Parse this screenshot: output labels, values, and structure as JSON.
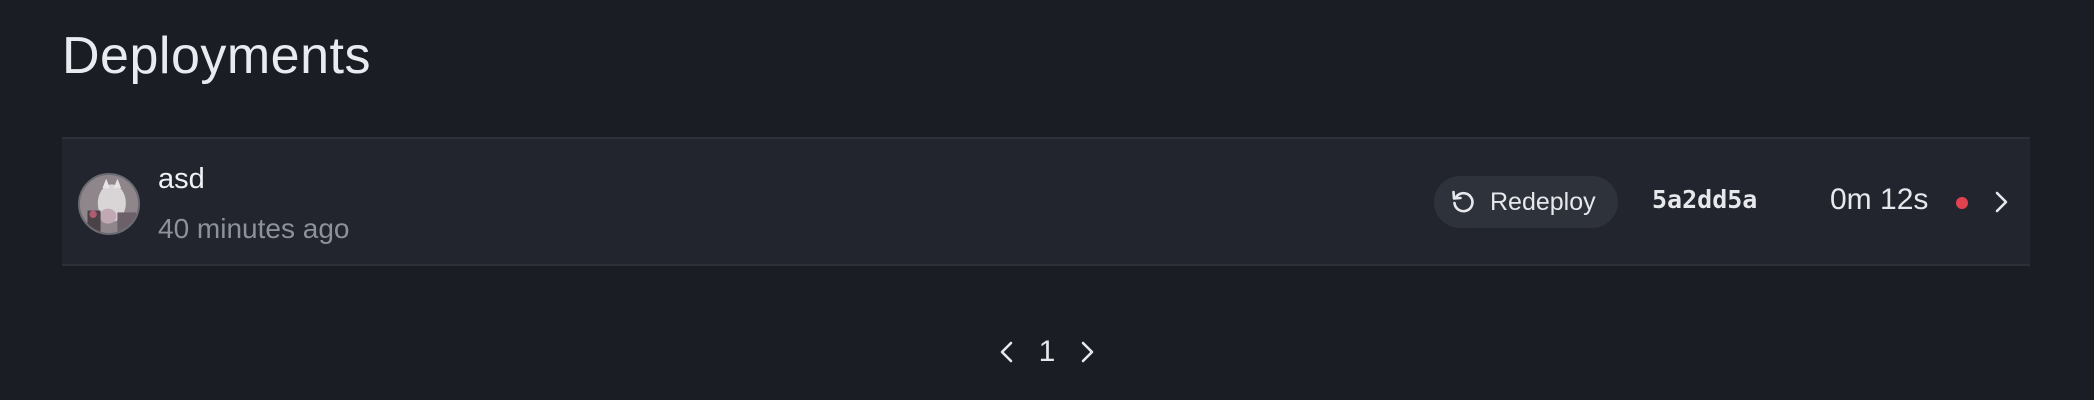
{
  "page": {
    "title": "Deployments"
  },
  "deployments": [
    {
      "name": "asd",
      "time_ago": "40 minutes ago",
      "redeploy_label": "Redeploy",
      "commit": "5a2dd5a",
      "duration": "0m 12s",
      "status_color": "#e0434f",
      "avatar_icon": "avatar-image",
      "action_icon": "chevron-right-icon"
    }
  ],
  "pagination": {
    "current_page": "1",
    "prev_icon": "chevron-left-icon",
    "next_icon": "chevron-right-icon"
  },
  "colors": {
    "background": "#1b1d24",
    "row_background": "#22252d",
    "button_background": "#2e323b",
    "status_failed": "#e0434f",
    "muted_text": "#8c919b"
  }
}
